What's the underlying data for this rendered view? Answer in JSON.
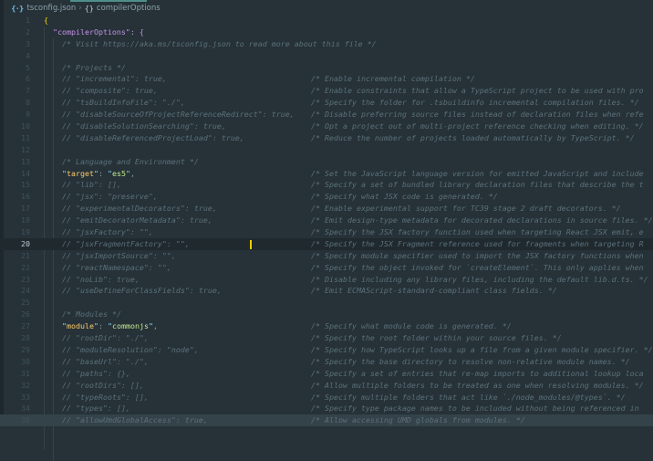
{
  "breadcrumb": {
    "file": "tsconfig.json",
    "section": "compilerOptions",
    "file_icon": "json-braces-icon",
    "section_icon": "object-braces-icon"
  },
  "editor": {
    "active_line": 20,
    "colors": {
      "background": "#263238",
      "key": "#ffcb6b",
      "string": "#c3e88d",
      "comment": "#5c707a"
    },
    "lines": [
      {
        "n": "1",
        "kind": "brace",
        "code": "{"
      },
      {
        "n": "2",
        "kind": "brace2",
        "code": "\"compilerOptions\": {"
      },
      {
        "n": "3",
        "kind": "comment",
        "code": "/* Visit https://aka.ms/tsconfig.json to read more about this file */"
      },
      {
        "n": "4",
        "kind": "blank",
        "code": ""
      },
      {
        "n": "5",
        "kind": "comment",
        "code": "/* Projects */"
      },
      {
        "n": "6",
        "kind": "comment",
        "code": "// \"incremental\": true,",
        "comment": "/* Enable incremental compilation */"
      },
      {
        "n": "7",
        "kind": "comment",
        "code": "// \"composite\": true,",
        "comment": "/* Enable constraints that allow a TypeScript project to be used with pro"
      },
      {
        "n": "8",
        "kind": "comment",
        "code": "// \"tsBuildInfoFile\": \"./\",",
        "comment": "/* Specify the folder for .tsbuildinfo incremental compilation files. */"
      },
      {
        "n": "9",
        "kind": "comment",
        "code": "// \"disableSourceOfProjectReferenceRedirect\": true,",
        "comment": "/* Disable preferring source files instead of declaration files when refe"
      },
      {
        "n": "10",
        "kind": "comment",
        "code": "// \"disableSolutionSearching\": true,",
        "comment": "/* Opt a project out of multi-project reference checking when editing. */"
      },
      {
        "n": "11",
        "kind": "comment",
        "code": "// \"disableReferencedProjectLoad\": true,",
        "comment": "/* Reduce the number of projects loaded automatically by TypeScript. */"
      },
      {
        "n": "12",
        "kind": "blank",
        "code": ""
      },
      {
        "n": "13",
        "kind": "comment",
        "code": "/* Language and Environment */"
      },
      {
        "n": "14",
        "kind": "prop",
        "key": "target",
        "value": "es5",
        "comment": "/* Set the JavaScript language version for emitted JavaScript and include"
      },
      {
        "n": "15",
        "kind": "comment",
        "code": "// \"lib\": [],",
        "comment": "/* Specify a set of bundled library declaration files that describe the t"
      },
      {
        "n": "16",
        "kind": "comment",
        "code": "// \"jsx\": \"preserve\",",
        "comment": "/* Specify what JSX code is generated. */"
      },
      {
        "n": "17",
        "kind": "comment",
        "code": "// \"experimentalDecorators\": true,",
        "comment": "/* Enable experimental support for TC39 stage 2 draft decorators. */"
      },
      {
        "n": "18",
        "kind": "comment",
        "code": "// \"emitDecoratorMetadata\": true,",
        "comment": "/* Emit design-type metadata for decorated declarations in source files. */"
      },
      {
        "n": "19",
        "kind": "comment",
        "code": "// \"jsxFactory\": \"\",",
        "comment": "/* Specify the JSX factory function used when targeting React JSX emit, e"
      },
      {
        "n": "20",
        "kind": "comment",
        "code": "// \"jsxFragmentFactory\": \"\",",
        "comment": "/* Specify the JSX Fragment reference used for fragments when targeting R"
      },
      {
        "n": "21",
        "kind": "comment",
        "code": "// \"jsxImportSource\": \"\",",
        "comment": "/* Specify module specifier used to import the JSX factory functions when"
      },
      {
        "n": "22",
        "kind": "comment",
        "code": "// \"reactNamespace\": \"\",",
        "comment": "/* Specify the object invoked for `createElement`. This only applies when"
      },
      {
        "n": "23",
        "kind": "comment",
        "code": "// \"noLib\": true,",
        "comment": "/* Disable including any library files, including the default lib.d.ts. */"
      },
      {
        "n": "24",
        "kind": "comment",
        "code": "// \"useDefineForClassFields\": true,",
        "comment": "/* Emit ECMAScript-standard-compliant class fields. */"
      },
      {
        "n": "25",
        "kind": "blank",
        "code": ""
      },
      {
        "n": "26",
        "kind": "comment",
        "code": "/* Modules */"
      },
      {
        "n": "27",
        "kind": "prop",
        "key": "module",
        "value": "commonjs",
        "comment": "/* Specify what module code is generated. */"
      },
      {
        "n": "28",
        "kind": "comment",
        "code": "// \"rootDir\": \"./\",",
        "comment": "/* Specify the root folder within your source files. */"
      },
      {
        "n": "29",
        "kind": "comment",
        "code": "// \"moduleResolution\": \"node\",",
        "comment": "/* Specify how TypeScript looks up a file from a given module specifier. */"
      },
      {
        "n": "30",
        "kind": "comment",
        "code": "// \"baseUrl\": \"./\",",
        "comment": "/* Specify the base directory to resolve non-relative module names. */"
      },
      {
        "n": "31",
        "kind": "comment",
        "code": "// \"paths\": {},",
        "comment": "/* Specify a set of entries that re-map imports to additional lookup loca"
      },
      {
        "n": "32",
        "kind": "comment",
        "code": "// \"rootDirs\": [],",
        "comment": "/* Allow multiple folders to be treated as one when resolving modules. */"
      },
      {
        "n": "33",
        "kind": "comment",
        "code": "// \"typeRoots\": [],",
        "comment": "/* Specify multiple folders that act like `./node_modules/@types`. */"
      },
      {
        "n": "34",
        "kind": "comment",
        "code": "// \"types\": [],",
        "comment": "/* Specify type package names to be included without being referenced in"
      },
      {
        "n": "35",
        "kind": "comment",
        "code": "// \"allowUmdGlobalAccess\": true,",
        "comment": "/* Allow accessing UMD globals from modules. */"
      }
    ]
  }
}
